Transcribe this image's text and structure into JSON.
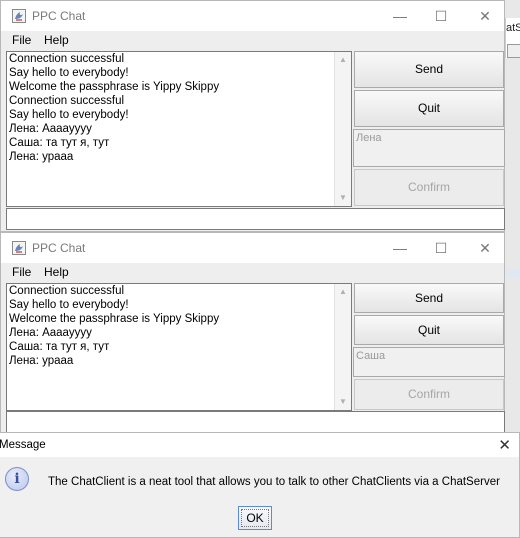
{
  "background": {
    "partial_text": "atSe",
    "arrow": ">"
  },
  "windows": [
    {
      "title": "PPC Chat",
      "menu": [
        "File",
        "Help"
      ],
      "controls": {
        "minimize": "—",
        "maximize": "☐",
        "close": "✕"
      },
      "messages": [
        "Connection successful",
        "Say hello to everybody!",
        "Welcome the passphrase is Yippy Skippy",
        "Connection successful",
        "Say hello to everybody!",
        "Лена: Aaaayyyy",
        "Саша: та тут я, тут",
        "Лена: ураaa"
      ],
      "send_label": "Send",
      "quit_label": "Quit",
      "name_value": "Лена",
      "confirm_label": "Confirm",
      "input_value": ""
    },
    {
      "title": "PPC Chat",
      "menu": [
        "File",
        "Help"
      ],
      "controls": {
        "minimize": "—",
        "maximize": "☐",
        "close": "✕"
      },
      "messages": [
        "Connection successful",
        "Say hello to everybody!",
        "Welcome the passphrase is Yippy Skippy",
        "Лена: Aaaayyyy",
        "Саша: та тут я, тут",
        "Лена: ураaa"
      ],
      "send_label": "Send",
      "quit_label": "Quit",
      "name_value": "Саша",
      "confirm_label": "Confirm",
      "input_value": ""
    }
  ],
  "dialog": {
    "title": "Message",
    "close": "✕",
    "icon_letter": "i",
    "icon": "info-icon",
    "message": "The ChatClient is a neat tool that allows you to talk to other ChatClients via a ChatServer",
    "ok_label": "OK"
  },
  "colors": {
    "window_bg": "#eeeeee",
    "disabled_text": "#a6a6a6",
    "focus_border": "#5b8ad6"
  }
}
